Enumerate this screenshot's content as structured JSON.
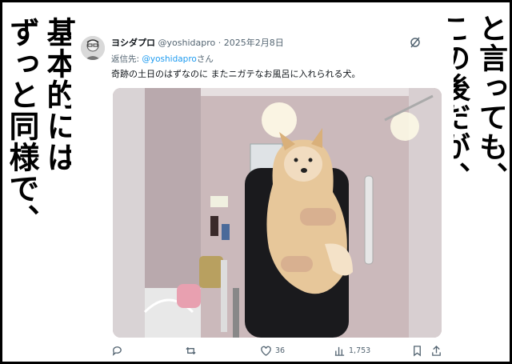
{
  "overlay": {
    "right_col1": "と言っても、",
    "right_col2": "この後だが、",
    "left_col1": "基本的には",
    "left_col2": "ずっと同様で、"
  },
  "tweet": {
    "display_name": "ヨシダプロ",
    "handle": "@yoshidapro",
    "separator": "·",
    "date": "2025年2月8日",
    "reply_prefix": "返信先: ",
    "reply_handle": "@yoshidapro",
    "reply_suffix": "さん",
    "text": "奇跡の土日のはずなのに またニガテなお風呂に入れられる犬。",
    "icons": {
      "grok": "grok-icon",
      "reply": "reply-icon",
      "retweet": "retweet-icon",
      "like": "like-icon",
      "views": "views-icon",
      "bookmark": "bookmark-icon",
      "share": "share-icon"
    },
    "counts": {
      "likes": "36",
      "views": "1,753"
    }
  },
  "colors": {
    "link": "#1d9bf0",
    "secondary_text": "#536471",
    "primary_text": "#0f1419"
  }
}
